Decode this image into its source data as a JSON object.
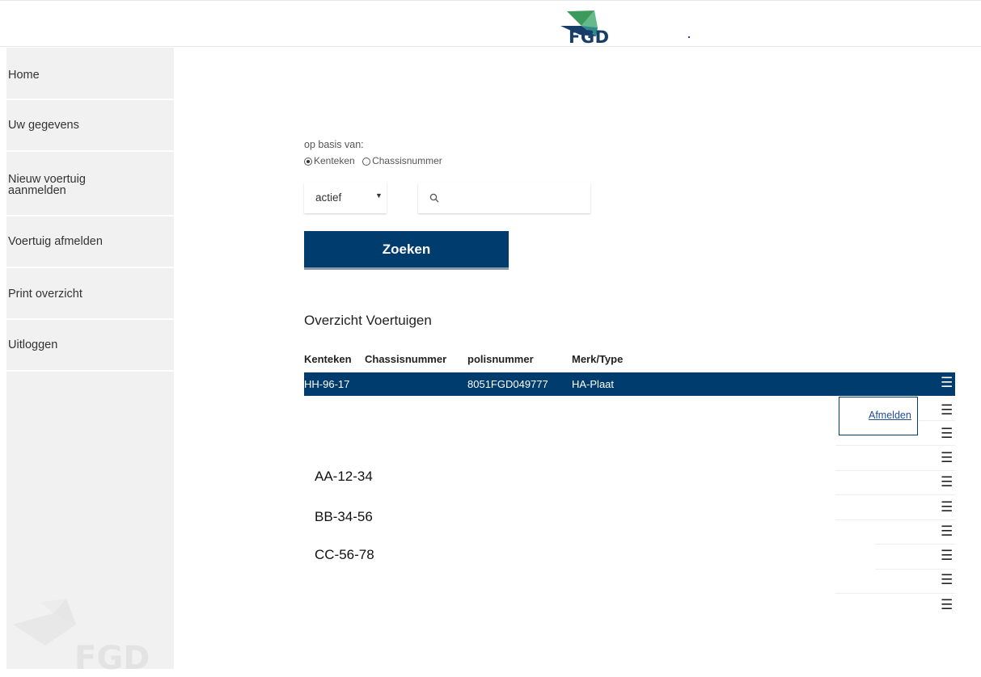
{
  "header": {
    "logo_text": "FGD",
    "brand_colors": {
      "navy": "#173d69",
      "green": "#3c9b5a",
      "teal": "#2f8a8b"
    }
  },
  "sidebar": {
    "items": [
      {
        "label": "Home"
      },
      {
        "label": "Uw gegevens"
      },
      {
        "label": "Nieuw voertuig aanmelden"
      },
      {
        "label": "Voertuig afmelden"
      },
      {
        "label": "Print overzicht"
      },
      {
        "label": "Uitloggen"
      }
    ],
    "watermark_text": "FGD"
  },
  "search": {
    "basis_label": "op basis van:",
    "options": [
      {
        "label": "Kenteken",
        "selected": true
      },
      {
        "label": "Chassisnummer",
        "selected": false
      }
    ],
    "status_select": "actief",
    "query_placeholder": "",
    "submit_label": "Zoeken"
  },
  "overview": {
    "title": "Overzicht Voertuigen",
    "columns": [
      "Kenteken",
      "Chassisnummer",
      "polisnummer",
      "Merk/Type"
    ],
    "selected_row": {
      "kenteken": "HH-96-17",
      "chassisnummer": "",
      "polisnummer": "8051FGD049777",
      "merk_type": "HA-Plaat"
    },
    "row_menu_action": "Afmelden",
    "menu_icon": "hamburger-icon",
    "extra_plates": [
      "AA-12-34",
      "BB-34-56",
      "CC-56-78"
    ],
    "accent_color": "#003c6e"
  }
}
